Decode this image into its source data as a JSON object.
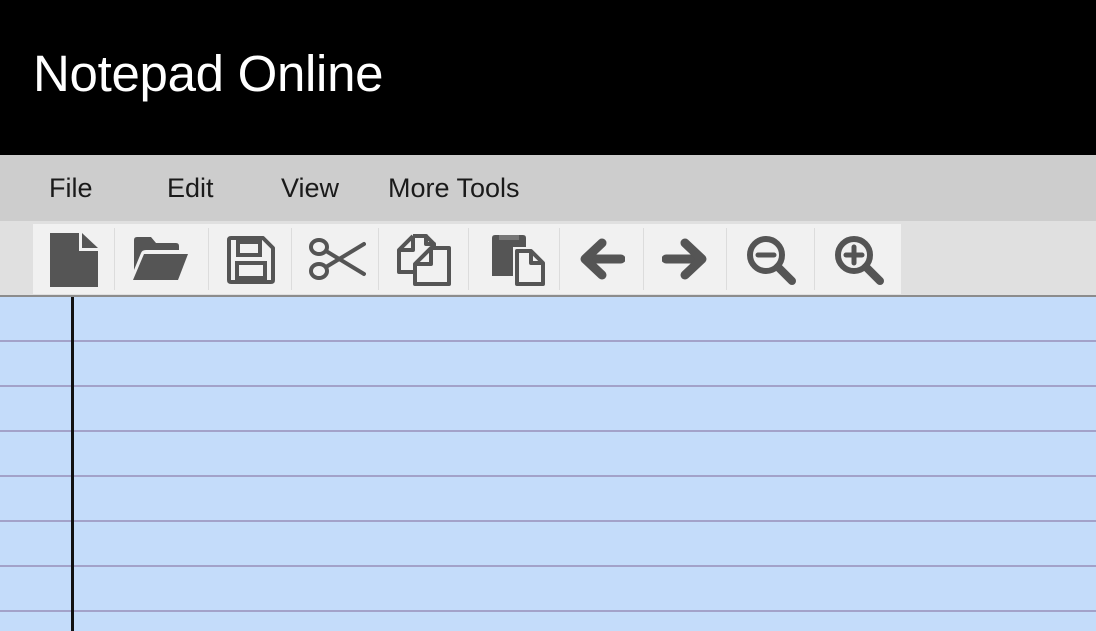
{
  "app": {
    "title": "Notepad Online"
  },
  "menu": {
    "items": [
      {
        "label": "File"
      },
      {
        "label": "Edit"
      },
      {
        "label": "View"
      },
      {
        "label": "More Tools"
      }
    ]
  },
  "toolbar": {
    "buttons": [
      {
        "icon": "new-file-icon",
        "action": "new"
      },
      {
        "icon": "folder-open-icon",
        "action": "open"
      },
      {
        "icon": "save-icon",
        "action": "save"
      },
      {
        "icon": "scissors-icon",
        "action": "cut"
      },
      {
        "icon": "copy-icon",
        "action": "copy"
      },
      {
        "icon": "paste-icon",
        "action": "paste"
      },
      {
        "icon": "arrow-left-icon",
        "action": "undo"
      },
      {
        "icon": "arrow-right-icon",
        "action": "redo"
      },
      {
        "icon": "zoom-out-icon",
        "action": "zoom-out"
      },
      {
        "icon": "zoom-in-icon",
        "action": "zoom-in"
      }
    ]
  },
  "editor": {
    "content": ""
  },
  "colors": {
    "title_bar": "#000000",
    "menu_bar": "#cdcdcd",
    "toolbar": "#f1f1f1",
    "icon": "#555555",
    "paper": "#c4dcfa",
    "rule_line": "#a3a2c9",
    "margin_line": "#111111"
  }
}
